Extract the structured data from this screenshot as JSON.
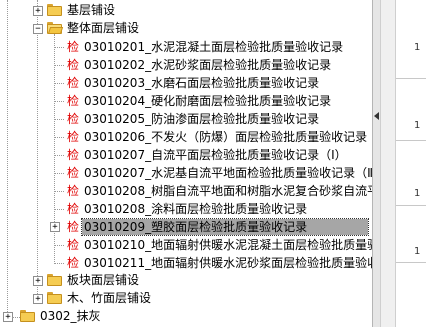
{
  "tree": {
    "folders": {
      "jiceng": "基层铺设",
      "zhengti": "整体面层铺设",
      "bankuai": "板块面层铺设",
      "muzhu": "木、竹面层铺设",
      "mohui": "0302_抹灰"
    },
    "check_marker": "检",
    "items": [
      "03010201_水泥混凝土面层检验批质量验收记录",
      "03010202_水泥砂浆面层检验批质量验收记录",
      "03010203_水磨石面层检验批质量验收记录",
      "03010204_硬化耐磨面层检验批质量验收记录",
      "03010205_防油渗面层检验批质量验收记录",
      "03010206_不发火（防爆）面层检验批质量验收记录",
      "03010207_自流平面层检验批质量验收记录（Ⅰ）",
      "03010207_水泥基自流平地面检验批质量验收记录（Ⅱ",
      "03010208_树脂自流平地面和树脂水泥复合砂浆自流平",
      "03010208_涂料面层检验批质量验收记录",
      "03010209_塑胶面层检验批质量验收记录",
      "03010210_地面辐射供暖水泥混凝土面层检验批质量验",
      "03010211_地面辐射供暖水泥砂浆面层检验批质量验收记"
    ]
  },
  "right_panel": {
    "row_numbers": [
      "1",
      "1",
      "1",
      "1"
    ]
  }
}
